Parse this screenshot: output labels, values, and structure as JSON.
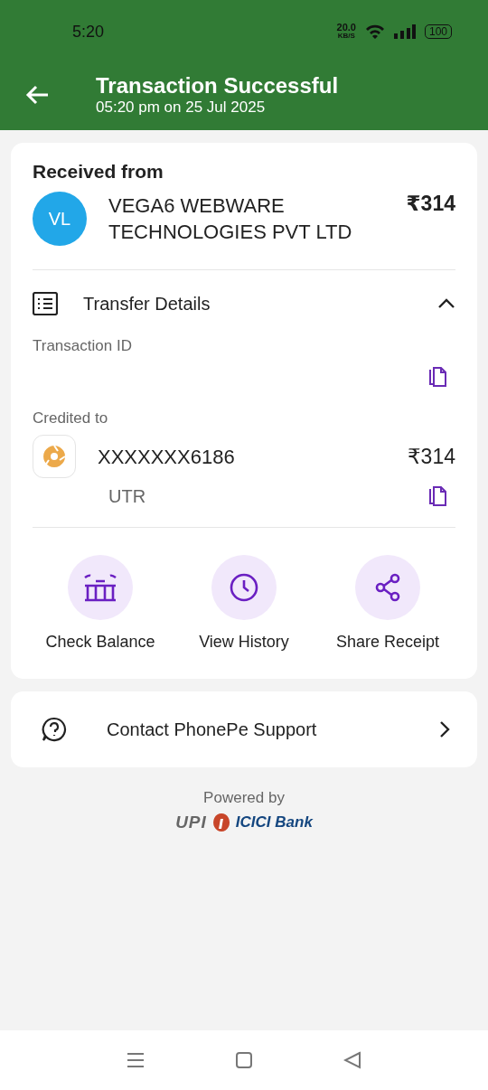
{
  "status_bar": {
    "time": "5:20",
    "speed": "20.0",
    "speed_unit": "KB/S",
    "battery": "100"
  },
  "header": {
    "title": "Transaction Successful",
    "subtitle": "05:20 pm on 25 Jul 2025"
  },
  "received": {
    "heading": "Received from",
    "initials": "VL",
    "name": "VEGA6 WEBWARE TECHNOLOGIES PVT LTD",
    "amount": "₹314"
  },
  "transfer_details": {
    "title": "Transfer Details",
    "expanded": true,
    "transaction_id_label": "Transaction ID",
    "credited_to_label": "Credited to",
    "account": "XXXXXXX6186",
    "amount": "₹314",
    "utr_label": "UTR"
  },
  "actions": [
    {
      "kind": "bank",
      "label": "Check Balance"
    },
    {
      "kind": "history",
      "label": "View History"
    },
    {
      "kind": "share",
      "label": "Share Receipt"
    }
  ],
  "support": {
    "label": "Contact PhonePe Support"
  },
  "footer": {
    "powered_by": "Powered by",
    "logos": [
      "UPI",
      "ICICI Bank"
    ]
  }
}
